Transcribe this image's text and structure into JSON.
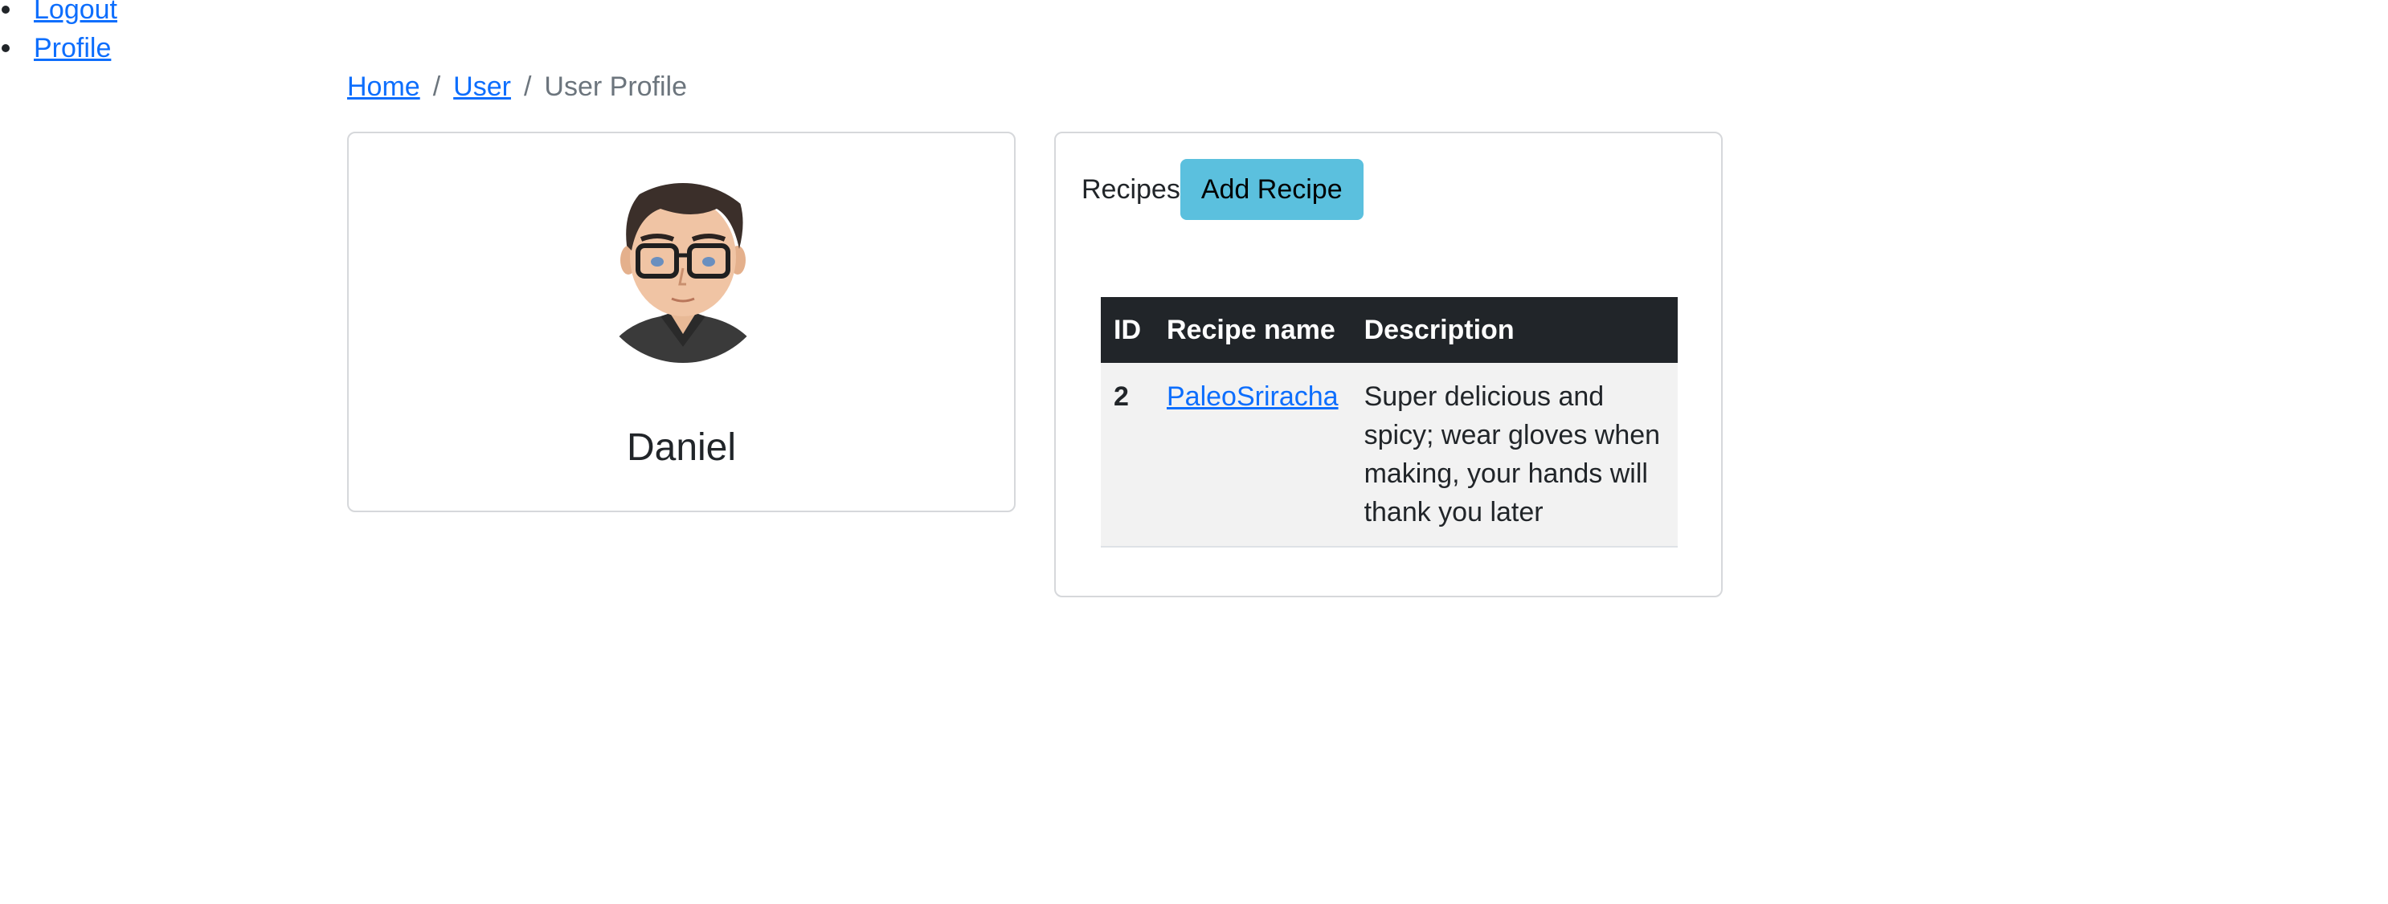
{
  "nav": {
    "items": [
      {
        "label": "Logout"
      },
      {
        "label": "Profile"
      }
    ]
  },
  "breadcrumb": {
    "home": "Home",
    "user": "User",
    "current": "User Profile",
    "separator": "/"
  },
  "profile": {
    "username": "Daniel",
    "avatar_icon": "user-avatar-cartoon"
  },
  "recipes": {
    "title": "Recipes",
    "add_button_label": "Add Recipe",
    "columns": [
      "ID",
      "Recipe name",
      "Description"
    ],
    "rows": [
      {
        "id": "2",
        "name": "PaleoSriracha",
        "description": "Super delicious and spicy; wear gloves when making, your hands will thank you later"
      }
    ]
  },
  "colors": {
    "link": "#0d6efd",
    "button_bg": "#5bc0de",
    "table_header_bg": "#212529",
    "table_row_bg": "#f2f2f2"
  }
}
